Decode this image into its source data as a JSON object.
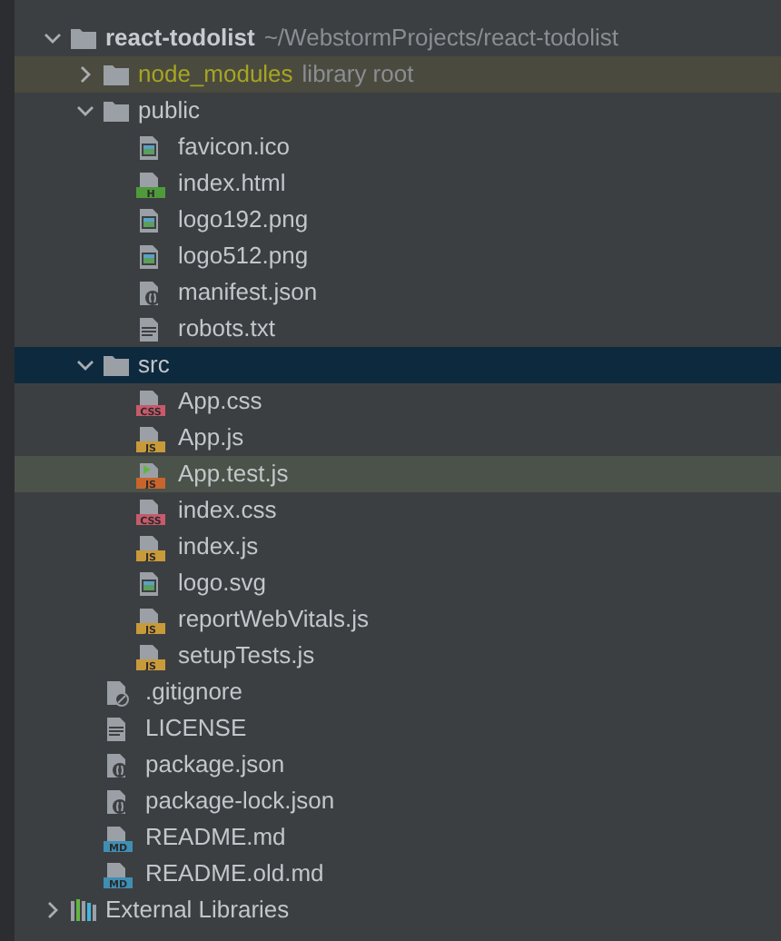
{
  "tree": [
    {
      "label": "react-todolist",
      "note": "~/WebstormProjects/react-todolist",
      "kind": "root",
      "expanded": true,
      "selected": false,
      "hovered": false,
      "children": [
        {
          "label": "node_modules",
          "note": "library root",
          "kind": "library",
          "expanded": false,
          "selected": false,
          "hovered": false
        },
        {
          "label": "public",
          "kind": "folder",
          "expanded": true,
          "selected": false,
          "hovered": false,
          "children": [
            {
              "label": "favicon.ico",
              "kind": "image",
              "selected": false,
              "hovered": false
            },
            {
              "label": "index.html",
              "kind": "html",
              "badge": "H",
              "selected": false,
              "hovered": false
            },
            {
              "label": "logo192.png",
              "kind": "image",
              "selected": false,
              "hovered": false
            },
            {
              "label": "logo512.png",
              "kind": "image",
              "selected": false,
              "hovered": false
            },
            {
              "label": "manifest.json",
              "kind": "json",
              "selected": false,
              "hovered": false
            },
            {
              "label": "robots.txt",
              "kind": "text",
              "selected": false,
              "hovered": false
            }
          ]
        },
        {
          "label": "src",
          "kind": "folder",
          "expanded": true,
          "selected": true,
          "hovered": false,
          "children": [
            {
              "label": "App.css",
              "kind": "css",
              "badge": "CSS",
              "selected": false,
              "hovered": false
            },
            {
              "label": "App.js",
              "kind": "js",
              "badge": "JS",
              "selected": false,
              "hovered": false
            },
            {
              "label": "App.test.js",
              "kind": "test",
              "badge": "JS",
              "selected": false,
              "hovered": true
            },
            {
              "label": "index.css",
              "kind": "css",
              "badge": "CSS",
              "selected": false,
              "hovered": false
            },
            {
              "label": "index.js",
              "kind": "js",
              "badge": "JS",
              "selected": false,
              "hovered": false
            },
            {
              "label": "logo.svg",
              "kind": "image",
              "selected": false,
              "hovered": false
            },
            {
              "label": "reportWebVitals.js",
              "kind": "js",
              "badge": "JS",
              "selected": false,
              "hovered": false
            },
            {
              "label": "setupTests.js",
              "kind": "js",
              "badge": "JS",
              "selected": false,
              "hovered": false
            }
          ]
        },
        {
          "label": ".gitignore",
          "kind": "ignore",
          "selected": false,
          "hovered": false
        },
        {
          "label": "LICENSE",
          "kind": "text",
          "selected": false,
          "hovered": false
        },
        {
          "label": "package.json",
          "kind": "json",
          "selected": false,
          "hovered": false
        },
        {
          "label": "package-lock.json",
          "kind": "json",
          "selected": false,
          "hovered": false
        },
        {
          "label": "README.md",
          "kind": "md",
          "badge": "MD",
          "selected": false,
          "hovered": false
        },
        {
          "label": "README.old.md",
          "kind": "md",
          "badge": "MD",
          "selected": false,
          "hovered": false
        }
      ]
    },
    {
      "label": "External Libraries",
      "kind": "libraries",
      "expanded": false,
      "selected": false,
      "hovered": false
    }
  ]
}
